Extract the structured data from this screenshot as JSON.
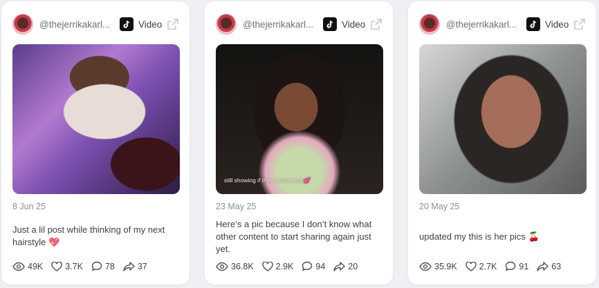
{
  "cards": [
    {
      "handle": "@thejerrikakarl...",
      "platform": "Video",
      "date": "8 Jun 25",
      "caption": "Just a lil post while thinking of my next hairstyle 💖",
      "views": "49K",
      "likes": "3.7K",
      "comments": "78",
      "shares": "37"
    },
    {
      "handle": "@thejerrikakarl...",
      "platform": "Video",
      "date": "23 May 25",
      "caption": "Here’s a pic because I don’t know what other content to start sharing again just yet.",
      "overlay": "still showing if they wondering 💕",
      "views": "36.8K",
      "likes": "2.9K",
      "comments": "94",
      "shares": "20"
    },
    {
      "handle": "@thejerrikakarl...",
      "platform": "Video",
      "date": "20 May 25",
      "caption": "updated my this is her pics 🍒",
      "views": "35.9K",
      "likes": "2.7K",
      "comments": "91",
      "shares": "63"
    }
  ],
  "colors": {
    "accent_heart": "#e02c6a",
    "text_muted": "#8a8e96",
    "text": "#3b3f47"
  },
  "icons": [
    "avatar",
    "tiktok-icon",
    "external-link-icon",
    "eye-icon",
    "heart-icon",
    "comment-icon",
    "share-icon"
  ]
}
